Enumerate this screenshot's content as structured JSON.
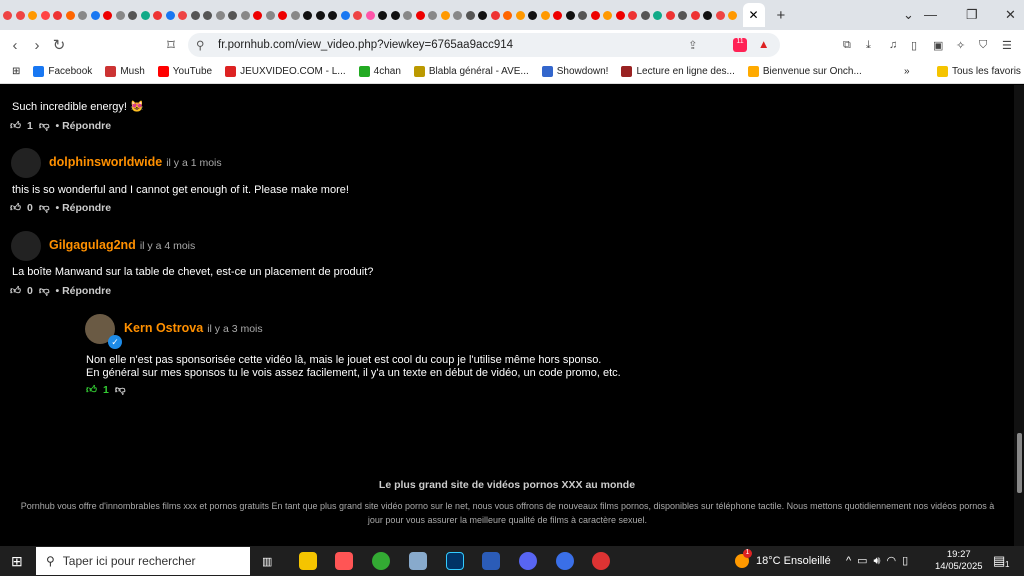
{
  "browser": {
    "url": "fr.pornhub.com/view_video.php?viewkey=6765aa9acc914",
    "brave_badge": "11",
    "tab_favicon_colors": [
      "#e44",
      "#e44",
      "#f90",
      "#f44",
      "#e33",
      "#f60",
      "#888",
      "#1877f2",
      "#e00",
      "#888",
      "#555",
      "#1a8",
      "#e33",
      "#1877f2",
      "#e44",
      "#555",
      "#555",
      "#888",
      "#555",
      "#888",
      "#e00",
      "#888",
      "#e00",
      "#888",
      "#111",
      "#111",
      "#111",
      "#1877f2",
      "#e44",
      "#f5a",
      "#111",
      "#111",
      "#888",
      "#e00",
      "#888",
      "#f90",
      "#888",
      "#555",
      "#111",
      "#e33",
      "#f60",
      "#f90",
      "#111",
      "#f90",
      "#e00",
      "#111",
      "#555",
      "#e00",
      "#f90",
      "#e00",
      "#e33",
      "#555",
      "#1a8",
      "#e33",
      "#555",
      "#e33",
      "#111",
      "#e44",
      "#f90"
    ],
    "bookmarks": [
      {
        "label": "Facebook",
        "color": "#1877f2"
      },
      {
        "label": "Mush",
        "color": "#c33"
      },
      {
        "label": "YouTube",
        "color": "#f00"
      },
      {
        "label": "JEUXVIDEO.COM - L...",
        "color": "#d22"
      },
      {
        "label": "4chan",
        "color": "#2a2"
      },
      {
        "label": "Blabla général - AVE...",
        "color": "#b90"
      },
      {
        "label": "Showdown!",
        "color": "#36c"
      },
      {
        "label": "Lecture en ligne des...",
        "color": "#922"
      },
      {
        "label": "Bienvenue sur Onch...",
        "color": "#fa0"
      }
    ],
    "bookmarks_more": "»",
    "favorites_folder": "Tous les favoris"
  },
  "comments": [
    {
      "text": "Such incredible energy! 😻",
      "likes": "1",
      "reply": "• Répondre"
    },
    {
      "user": "dolphinsworldwide",
      "time": "il y a 1 mois",
      "text": "this is so wonderful and I cannot get enough of it. Please make more!",
      "likes": "0",
      "reply": "• Répondre"
    },
    {
      "user": "Gilgagulag2nd",
      "time": "il y a 4 mois",
      "text": "La boîte Manwand sur la table de chevet, est-ce un placement de produit?",
      "likes": "0",
      "reply": "• Répondre"
    },
    {
      "user": "Kern Ostrova",
      "time": "il y a 3 mois",
      "text1": " Non elle n'est pas sponsorisée cette vidéo là, mais le jouet est cool du coup je l'utilise même hors sponso.",
      "text2": "En général sur mes sponsos tu le vois assez facilement, il y'a un texte en début de vidéo, un code promo, etc.",
      "likes": "1"
    }
  ],
  "footer": {
    "heading": "Le plus grand site de vidéos pornos XXX au monde",
    "text": "Pornhub vous offre d'innombrables films xxx et pornos gratuits En tant que plus grand site vidéo porno sur le net, nous vous offrons de nouveaux films pornos, disponibles sur téléphone tactile. Nous mettons quotidiennement nos vidéos pornos à jour pour vous assurer la meilleure qualité de films à caractère sexuel."
  },
  "taskbar": {
    "search_placeholder": "Taper ici pour rechercher",
    "weather": "18°C  Ensoleillé",
    "weather_badge": "1",
    "time": "19:27",
    "date": "14/05/2025",
    "notif": "1"
  }
}
